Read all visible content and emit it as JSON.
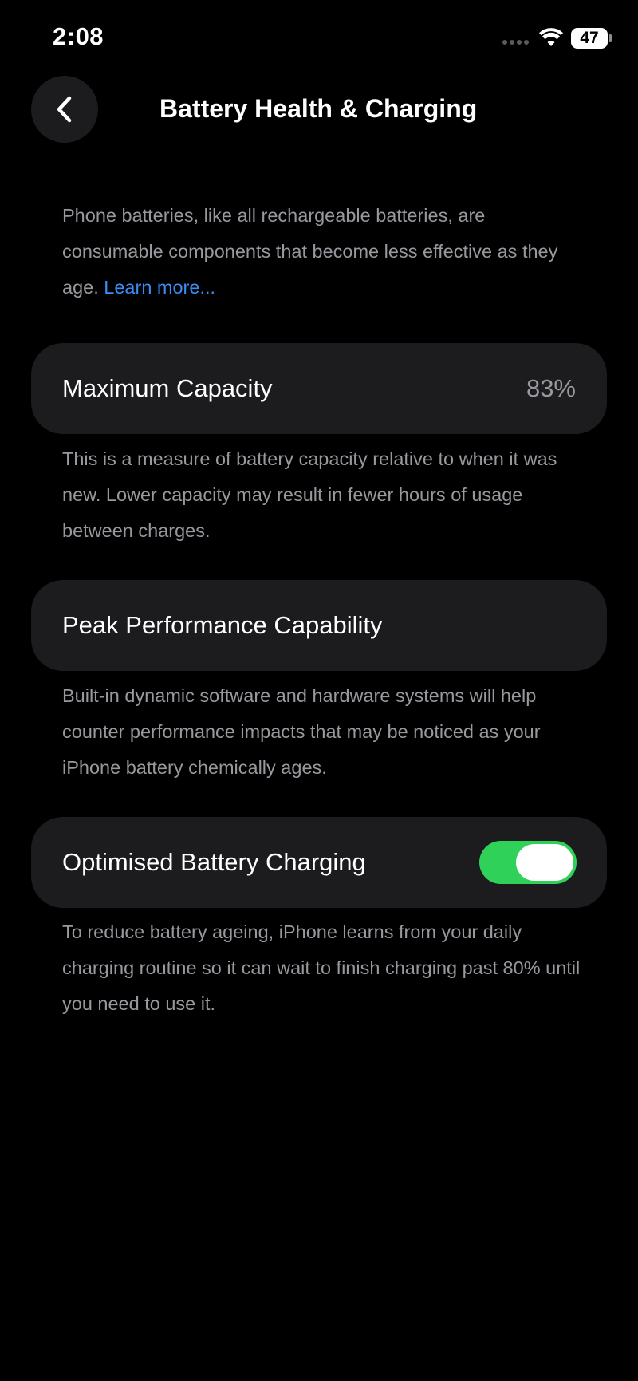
{
  "status_bar": {
    "time": "2:08",
    "battery_level": "47"
  },
  "nav": {
    "title": "Battery Health & Charging"
  },
  "intro": {
    "text": "Phone batteries, like all rechargeable batteries, are consumable components that become less effective as they age.",
    "link_label": "Learn more..."
  },
  "max_capacity": {
    "label": "Maximum Capacity",
    "value": "83%",
    "footnote": "This is a measure of battery capacity relative to when it was new. Lower capacity may result in fewer hours of usage between charges."
  },
  "peak_performance": {
    "label": "Peak Performance Capability",
    "footnote": "Built-in dynamic software and hardware systems will help counter performance impacts that may be noticed as your iPhone battery chemically ages."
  },
  "optimised_charging": {
    "label": "Optimised Battery Charging",
    "enabled": true,
    "footnote": "To reduce battery ageing, iPhone learns from your daily charging routine so it can wait to finish charging past 80% until you need to use it."
  },
  "colors": {
    "background": "#000000",
    "card": "#1c1c1e",
    "secondary_text": "#98989e",
    "link": "#3b8cf5",
    "toggle_on": "#30d158"
  },
  "icons": {
    "back": "chevron-left-icon",
    "wifi": "wifi-icon",
    "cellular": "cellular-signal-icon",
    "battery": "battery-icon"
  }
}
